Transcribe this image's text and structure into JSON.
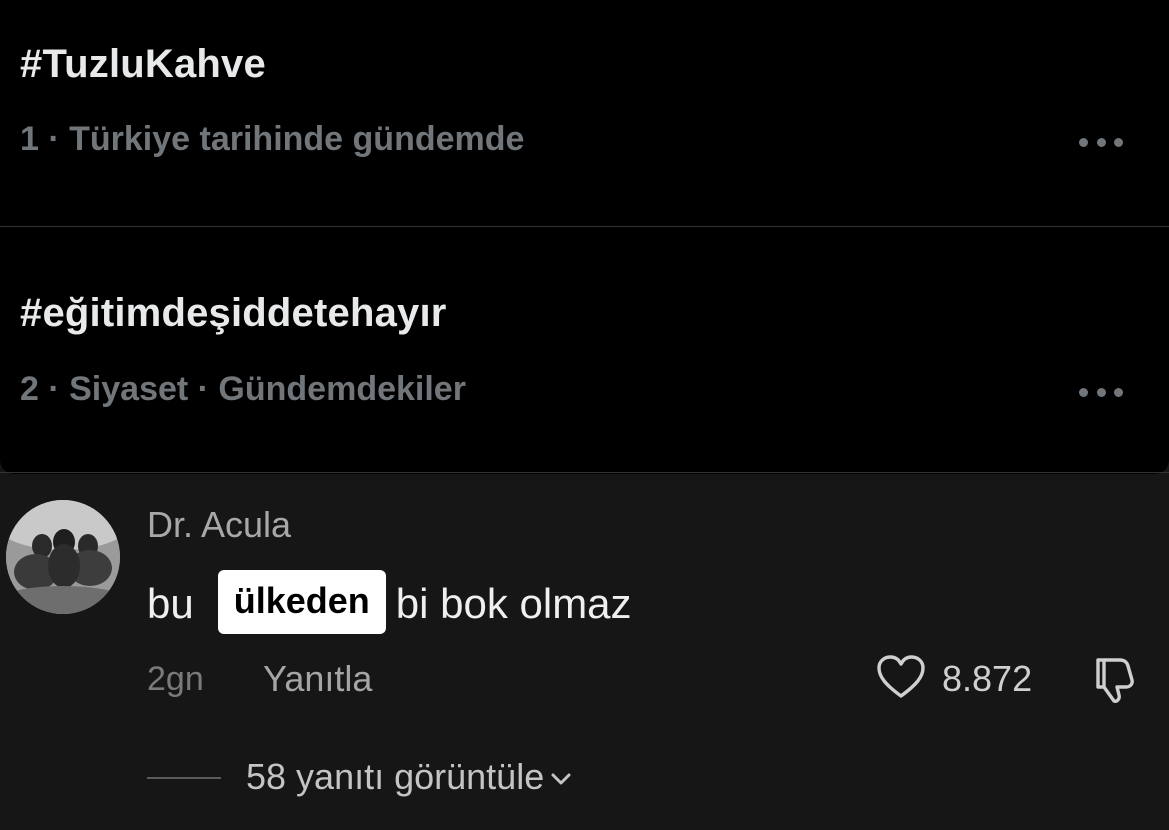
{
  "trends": [
    {
      "hashtag": "#TuzluKahve",
      "meta": "1 · Türkiye tarihinde gündemde",
      "more_icon": "more-horizontal-icon"
    },
    {
      "hashtag": "#eğitimdeşiddetehayır",
      "meta": "2 · Siyaset · Gündemdekiler",
      "more_icon": "more-horizontal-icon"
    }
  ],
  "comment": {
    "username": "Dr. Acula",
    "text_before": "bu",
    "highlighted_word": "ülkeden",
    "text_after": "bi bok olmaz",
    "time": "2gn",
    "reply_label": "Yanıtla",
    "like_count": "8.872",
    "like_icon": "heart-icon",
    "dislike_icon": "dislike-icon",
    "view_replies_label": "58 yanıtı görüntüle"
  },
  "colors": {
    "trends_background": "#000000",
    "comment_background": "#161616",
    "primary_text": "#e7e9ea",
    "secondary_text": "#71767b",
    "highlight_background": "#ffffff"
  }
}
